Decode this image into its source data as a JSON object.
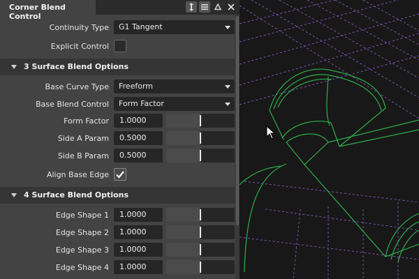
{
  "panel": {
    "title": "Corner Blend Control",
    "icons": [
      "resize-icon",
      "menu-icon",
      "collapse-icon",
      "close-icon"
    ]
  },
  "continuity": {
    "label": "Continuity Type",
    "value": "G1 Tangent"
  },
  "explicit_control": {
    "label": "Explicit Control",
    "checked": false
  },
  "section3": {
    "title": "3 Surface Blend Options",
    "base_curve_type": {
      "label": "Base Curve Type",
      "value": "Freeform"
    },
    "base_blend_control": {
      "label": "Base Blend Control",
      "value": "Form Factor"
    },
    "form_factor": {
      "label": "Form Factor",
      "value": "1.0000",
      "slider": 0.5
    },
    "side_a": {
      "label": "Side A Param",
      "value": "0.5000",
      "slider": 0.5
    },
    "side_b": {
      "label": "Side B Param",
      "value": "0.5000",
      "slider": 0.5
    },
    "align_base_edge": {
      "label": "Align Base Edge",
      "checked": true
    }
  },
  "section4": {
    "title": "4 Surface Blend Options",
    "edge1": {
      "label": "Edge Shape 1",
      "value": "1.0000",
      "slider": 0.5
    },
    "edge2": {
      "label": "Edge Shape 2",
      "value": "1.0000",
      "slider": 0.5
    },
    "edge3": {
      "label": "Edge Shape 3",
      "value": "1.0000",
      "slider": 0.5
    },
    "edge4": {
      "label": "Edge Shape 4",
      "value": "1.0000",
      "slider": 0.5
    }
  },
  "colors": {
    "panel_bg": "#434343",
    "field_bg": "#262626",
    "grid_purple": "#8a5fc9",
    "curve_green": "#2fae4a"
  }
}
